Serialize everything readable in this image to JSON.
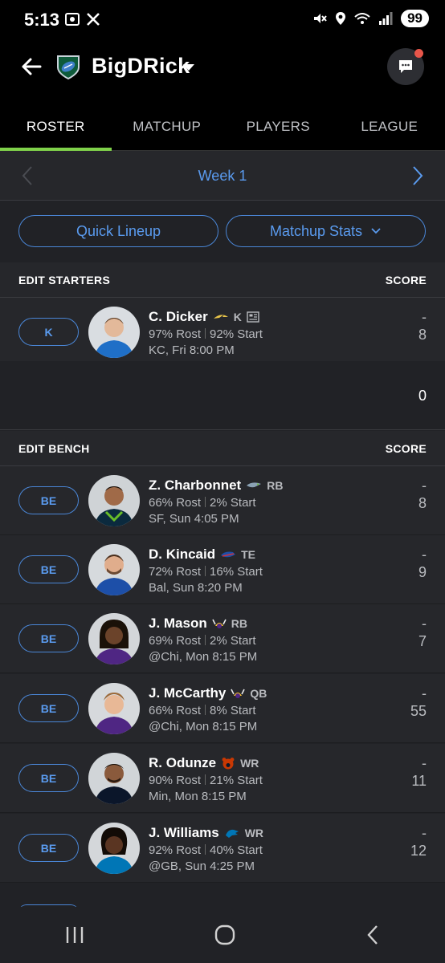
{
  "status_bar": {
    "time": "5:13",
    "battery": "99"
  },
  "header": {
    "team_name": "BigDRick"
  },
  "tabs": [
    {
      "label": "ROSTER",
      "active": true
    },
    {
      "label": "MATCHUP",
      "active": false
    },
    {
      "label": "PLAYERS",
      "active": false
    },
    {
      "label": "LEAGUE",
      "active": false
    }
  ],
  "week": {
    "label": "Week 1"
  },
  "actions": {
    "quick_lineup": "Quick Lineup",
    "matchup_stats": "Matchup Stats"
  },
  "starters_section": {
    "title": "EDIT STARTERS",
    "score_label": "SCORE"
  },
  "starters": [
    {
      "slot": "K",
      "name": "C. Dicker",
      "position": "K",
      "rost": "97% Rost",
      "start": "92% Start",
      "game": "KC,  Fri 8:00 PM",
      "score": "-",
      "projected": "8"
    }
  ],
  "starters_total": "0",
  "bench_section": {
    "title": "EDIT BENCH",
    "score_label": "SCORE"
  },
  "bench": [
    {
      "slot": "BE",
      "name": "Z. Charbonnet",
      "position": "RB",
      "rost": "66% Rost",
      "start": "2% Start",
      "game": "SF,  Sun 4:05 PM",
      "score": "-",
      "projected": "8"
    },
    {
      "slot": "BE",
      "name": "D. Kincaid",
      "position": "TE",
      "rost": "72% Rost",
      "start": "16% Start",
      "game": "Bal,  Sun 8:20 PM",
      "score": "-",
      "projected": "9"
    },
    {
      "slot": "BE",
      "name": "J. Mason",
      "position": "RB",
      "rost": "69% Rost",
      "start": "2% Start",
      "game": "@Chi,  Mon 8:15 PM",
      "score": "-",
      "projected": "7"
    },
    {
      "slot": "BE",
      "name": "J. McCarthy",
      "position": "QB",
      "rost": "66% Rost",
      "start": "8% Start",
      "game": "@Chi,  Mon 8:15 PM",
      "score": "-",
      "projected": "55"
    },
    {
      "slot": "BE",
      "name": "R. Odunze",
      "position": "WR",
      "rost": "90% Rost",
      "start": "21% Start",
      "game": "Min,  Mon 8:15 PM",
      "score": "-",
      "projected": "11"
    },
    {
      "slot": "BE",
      "name": "J. Williams",
      "position": "WR",
      "rost": "92% Rost",
      "start": "40% Start",
      "game": "@GB,  Sun 4:25 PM",
      "score": "-",
      "projected": "12"
    }
  ]
}
